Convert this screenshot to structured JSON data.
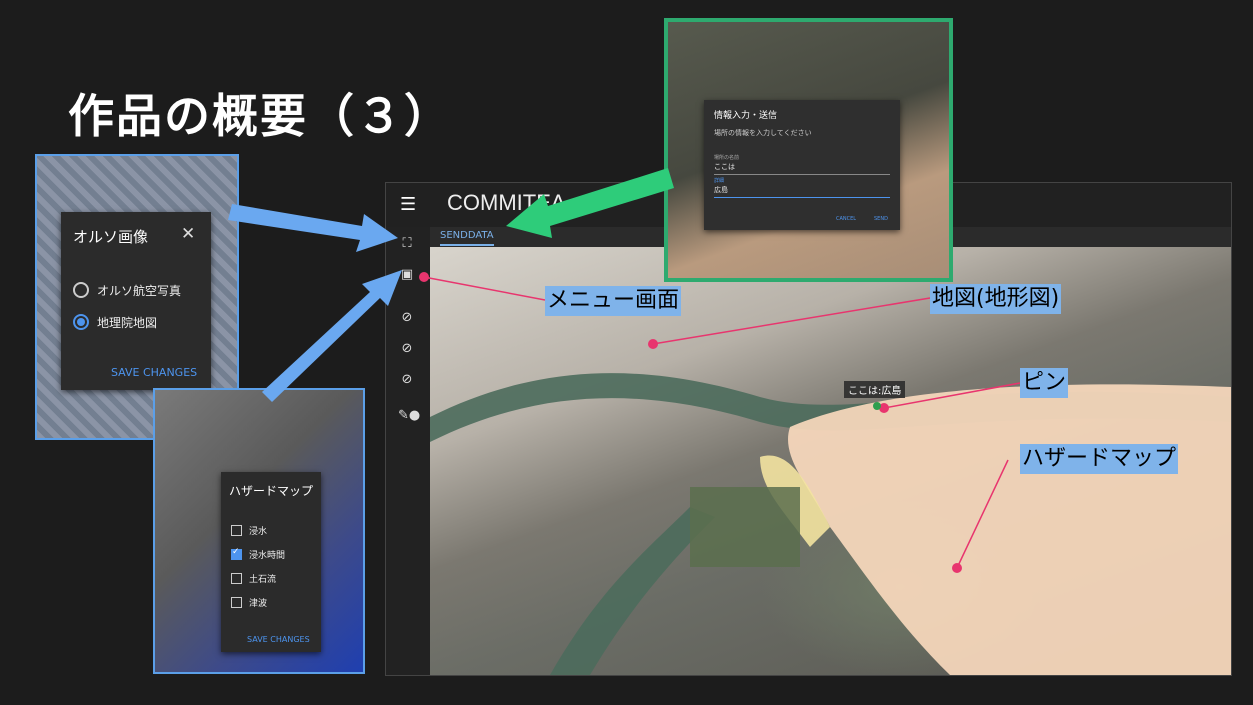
{
  "slide": {
    "title": "作品の概要（３）"
  },
  "app": {
    "title": "COMMITEA",
    "tab": "SENDDATA",
    "map_pin_label": "ここは:広島"
  },
  "ortho_dialog": {
    "title": "オルソ画像",
    "options": [
      {
        "label": "オルソ航空写真",
        "selected": false
      },
      {
        "label": "地理院地図",
        "selected": true
      }
    ],
    "save": "SAVE CHANGES"
  },
  "hazard_dialog": {
    "title": "ハザードマップ",
    "options": [
      {
        "label": "浸水",
        "checked": false
      },
      {
        "label": "浸水時間",
        "checked": true
      },
      {
        "label": "土石流",
        "checked": false
      },
      {
        "label": "津波",
        "checked": false
      }
    ],
    "save": "SAVE CHANGES"
  },
  "info_dialog": {
    "title": "情報入力・送信",
    "subtitle": "場所の情報を入力してください",
    "name_label": "場所の名前",
    "name_value": "ここは",
    "detail_label": "詳細",
    "detail_value": "広島",
    "cancel": "CANCEL",
    "send": "SEND"
  },
  "callouts": {
    "menu": "メニュー画面",
    "map": "地図(地形図)",
    "pin": "ピン",
    "hazard": "ハザードマップ"
  },
  "colors": {
    "frame_blue": "#5b9fe8",
    "frame_green": "#2eaa6f",
    "callout_bg": "#7fb3ea",
    "pointer_pink": "#e8356e",
    "hazard_fill": "#f9d9bd"
  }
}
